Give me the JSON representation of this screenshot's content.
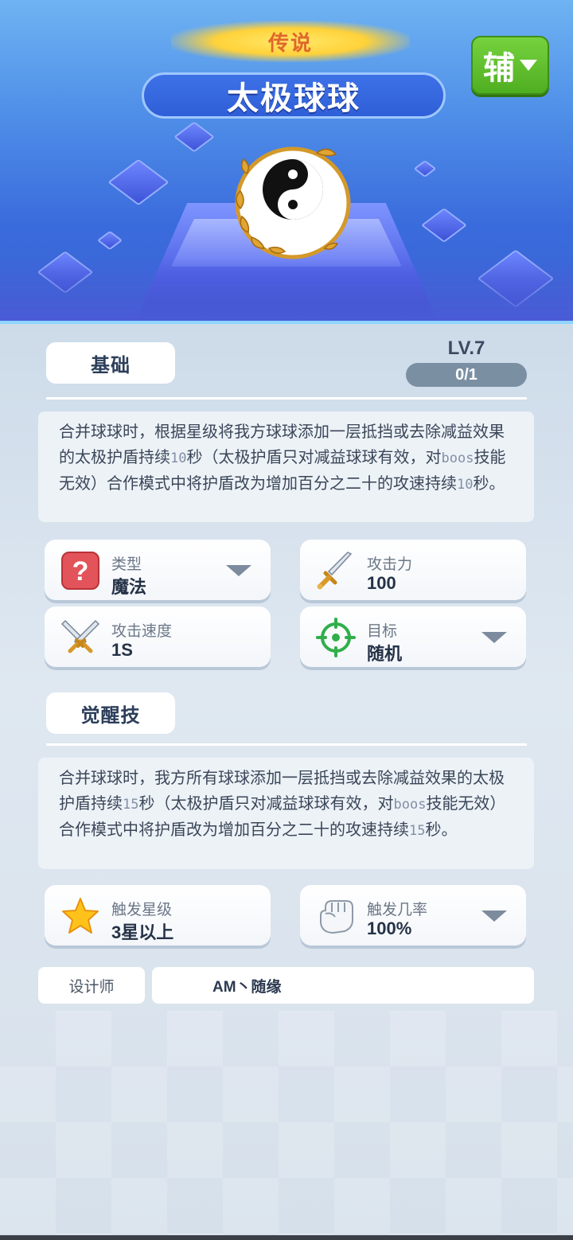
{
  "hero": {
    "rarity": "传说",
    "name": "太极球球",
    "role_button": "辅"
  },
  "basic": {
    "section_label": "基础",
    "level": "LV.7",
    "progress": "0/1",
    "progress_fraction": 0,
    "desc_parts": [
      "合并球球时，根据星级将我方球球添加一层抵挡或去除减益效果的太极护盾持续",
      "10",
      "秒（太极护盾只对减益球球有效，对",
      "boos",
      "技能无效）合作模式中将护盾改为增加百分之二十的攻速持续",
      "10",
      "秒。"
    ]
  },
  "stats": {
    "type_label": "类型",
    "type_value": "魔法",
    "attack_label": "攻击力",
    "attack_value": "100",
    "speed_label": "攻击速度",
    "speed_value": "1S",
    "target_label": "目标",
    "target_value": "随机"
  },
  "awaken": {
    "section_label": "觉醒技",
    "desc_parts": [
      "合并球球时，我方所有球球添加一层抵挡或去除减益效果的太极护盾持续",
      "15",
      "秒（太极护盾只对减益球球有效，对",
      "boos",
      "技能无效）合作模式中将护盾改为增加百分之二十的攻速持续",
      "15",
      "秒。"
    ],
    "trigger_star_label": "触发星级",
    "trigger_star_value": "3星以上",
    "trigger_rate_label": "触发几率",
    "trigger_rate_value": "100%"
  },
  "designer": {
    "label": "设计师",
    "value": "AM丶随缘"
  },
  "icons": [
    "question-icon",
    "sword-icon",
    "crossed-swords-icon",
    "target-icon",
    "star-icon",
    "fist-icon",
    "yin-yang-icon",
    "dropdown-arrow-icon"
  ],
  "colors": {
    "accent_green": "#5dbf2c",
    "rarity_gold": "#ffd23a",
    "panel_bg": "#dfe8f1"
  }
}
